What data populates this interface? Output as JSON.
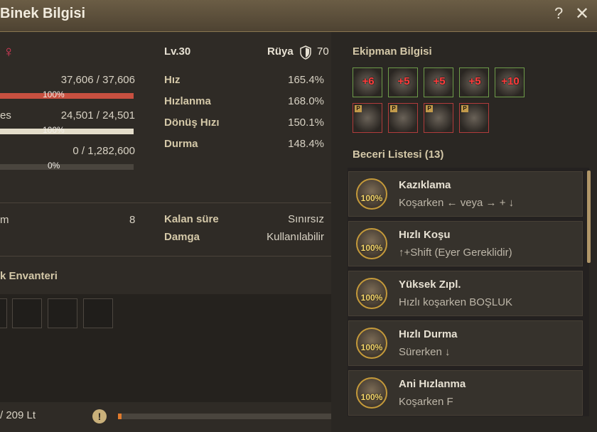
{
  "window": {
    "title": "Binek Bilgisi",
    "help": "?",
    "close": "✕"
  },
  "mount": {
    "gender_icon": "female-icon",
    "level": "Lv.30",
    "ruya_label": "Rüya",
    "ruya_value": "70",
    "hp": {
      "current": "37,606",
      "max": "37,606",
      "pct": "100%",
      "fill": 1.0,
      "color": "#c85040"
    },
    "stamina": {
      "label_fragment": "es",
      "current": "24,501",
      "max": "24,501",
      "pct": "100%",
      "fill": 1.0,
      "color": "#e4ddca"
    },
    "exp": {
      "current": "0",
      "max": "1,282,600",
      "pct": "0%",
      "fill": 0.0
    },
    "stats": [
      {
        "label": "Hız",
        "value": "165.4%"
      },
      {
        "label": "Hızlanma",
        "value": "168.0%"
      },
      {
        "label": "Dönüş Hızı",
        "value": "150.1%"
      },
      {
        "label": "Durma",
        "value": "148.4%"
      }
    ],
    "misc_label_fragment": "m",
    "misc_value": "8",
    "remaining_label": "Kalan süre",
    "remaining_value": "Sınırsız",
    "brand_label": "Damga",
    "brand_value": "Kullanılabilir",
    "inventory_title": "k Envanteri",
    "weight": {
      "text": "/ 209 Lt",
      "fill": 0.015
    }
  },
  "equipment": {
    "title": "Ekipman Bilgisi",
    "row1": [
      "+6",
      "+5",
      "+5",
      "+5",
      "+10"
    ],
    "row2_badge": "P"
  },
  "skills": {
    "title": "Beceri Listesi (13)",
    "items": [
      {
        "name": "Kazıklama",
        "desc": "Koşarken ← veya → + ↓",
        "pct": "100%"
      },
      {
        "name": "Hızlı Koşu",
        "desc": "↑+Shift (Eyer Gereklidir)",
        "pct": "100%"
      },
      {
        "name": "Yüksek Zıpl.",
        "desc": "Hızlı koşarken BOŞLUK",
        "pct": "100%"
      },
      {
        "name": "Hızlı Durma",
        "desc": "Sürerken ↓",
        "pct": "100%"
      },
      {
        "name": "Ani Hızlanma",
        "desc": "Koşarken F",
        "pct": "100%"
      }
    ]
  }
}
